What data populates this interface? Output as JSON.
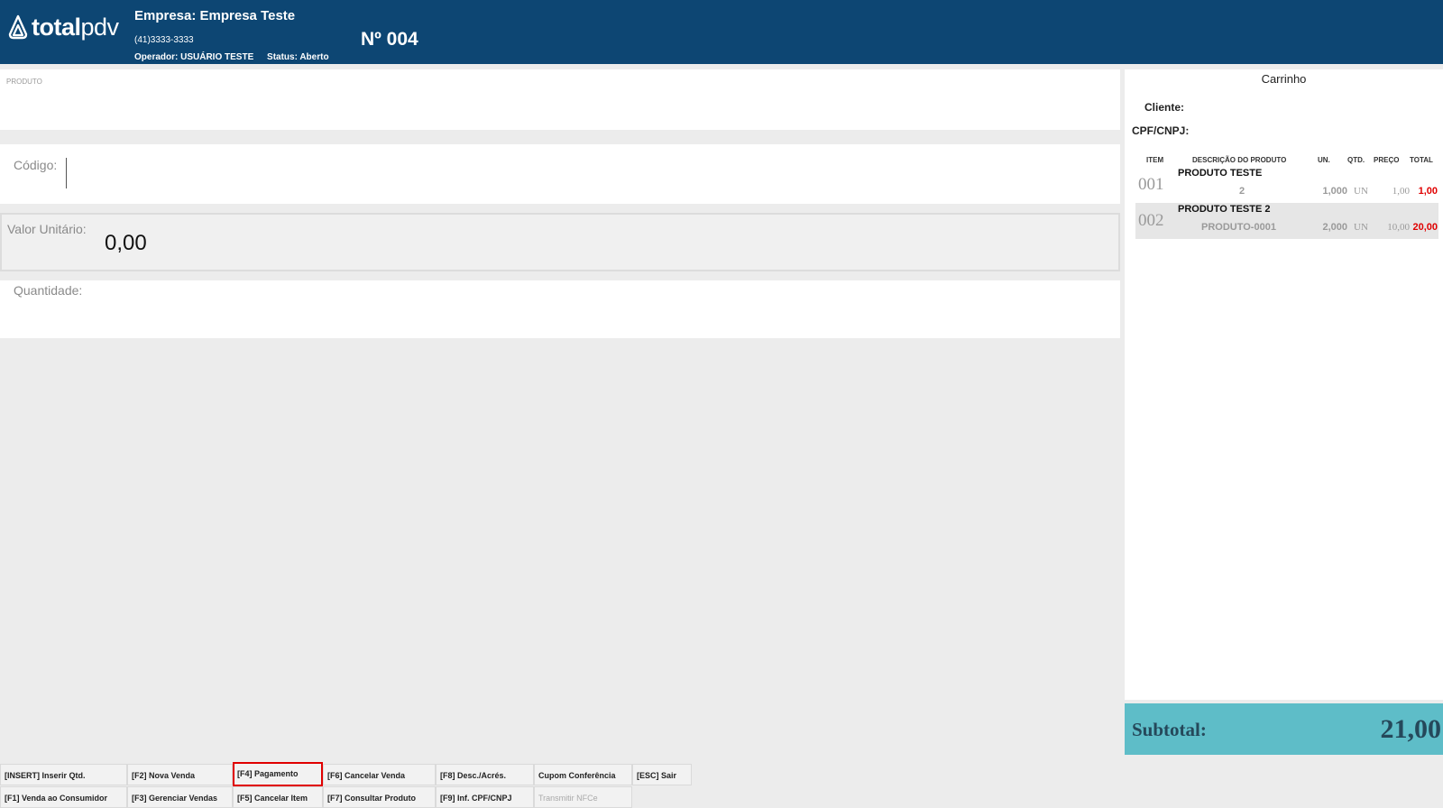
{
  "header": {
    "logo_bold": "total",
    "logo_light": "pdv",
    "company": "Empresa: Empresa Teste",
    "phone": "(41)3333-3333",
    "operator": "Operador: USUÁRIO TESTE",
    "status": "Status: Aberto",
    "sale_number": "Nº 004",
    "color": "#0d4673"
  },
  "form": {
    "produto_label": "PRODUTO",
    "codigo_label": "Código:",
    "valor_label": "Valor Unitário:",
    "valor_value": "0,00",
    "quantidade_label": "Quantidade:"
  },
  "cart": {
    "title": "Carrinho",
    "cliente_label": "Cliente:",
    "cpf_label": "CPF/CNPJ:",
    "columns": [
      "ITEM",
      "DESCRIÇÃO DO PRODUTO",
      "UN.",
      "QTD.",
      "PREÇO",
      "TOTAL"
    ],
    "items": [
      {
        "num": "001",
        "desc": "PRODUTO TESTE",
        "code": "2",
        "qtd": "1,000",
        "un": "UN",
        "preco": "1,00",
        "total": "1,00"
      },
      {
        "num": "002",
        "desc": "PRODUTO TESTE 2",
        "code": "PRODUTO-0001",
        "qtd": "2,000",
        "un": "UN",
        "preco": "10,00",
        "total": "20,00"
      }
    ]
  },
  "subtotal": {
    "label": "Subtotal:",
    "value": "21,00",
    "color": "#5ebdc8"
  },
  "footer": {
    "row1": [
      "[INSERT] Inserir Qtd.",
      "[F2] Nova Venda",
      "[F4] Pagamento",
      "[F6] Cancelar Venda",
      "[F8] Desc./Acrés.",
      "Cupom Conferência",
      "[ESC] Sair"
    ],
    "row2": [
      "[F1] Venda ao Consumidor",
      "[F3] Gerenciar Vendas",
      "[F5] Cancelar Item",
      "[F7] Consultar Produto",
      "[F9] Inf. CPF/CNPJ",
      "Transmitir NFCe"
    ]
  }
}
